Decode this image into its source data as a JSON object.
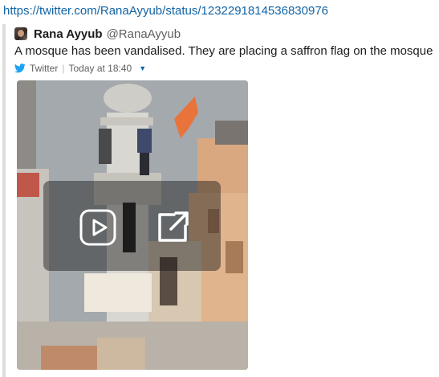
{
  "link": {
    "url_text": "https://twitter.com/RanaAyyub/status/1232291814536830976"
  },
  "attachment": {
    "author_name": "Rana Ayyub",
    "author_handle": "@RanaAyyub",
    "text": "A mosque has been vandalised. They are placing a saffron flag on the mosque",
    "footer": {
      "service": "Twitter",
      "timestamp": "Today at 18:40"
    },
    "media": {
      "type": "video",
      "play_icon": "play-icon",
      "open_icon": "open-external-icon"
    }
  },
  "colors": {
    "link": "#1264a3",
    "twitter_blue": "#1da1f2",
    "attachment_border": "#dddddd",
    "flag": "#e8743b"
  }
}
